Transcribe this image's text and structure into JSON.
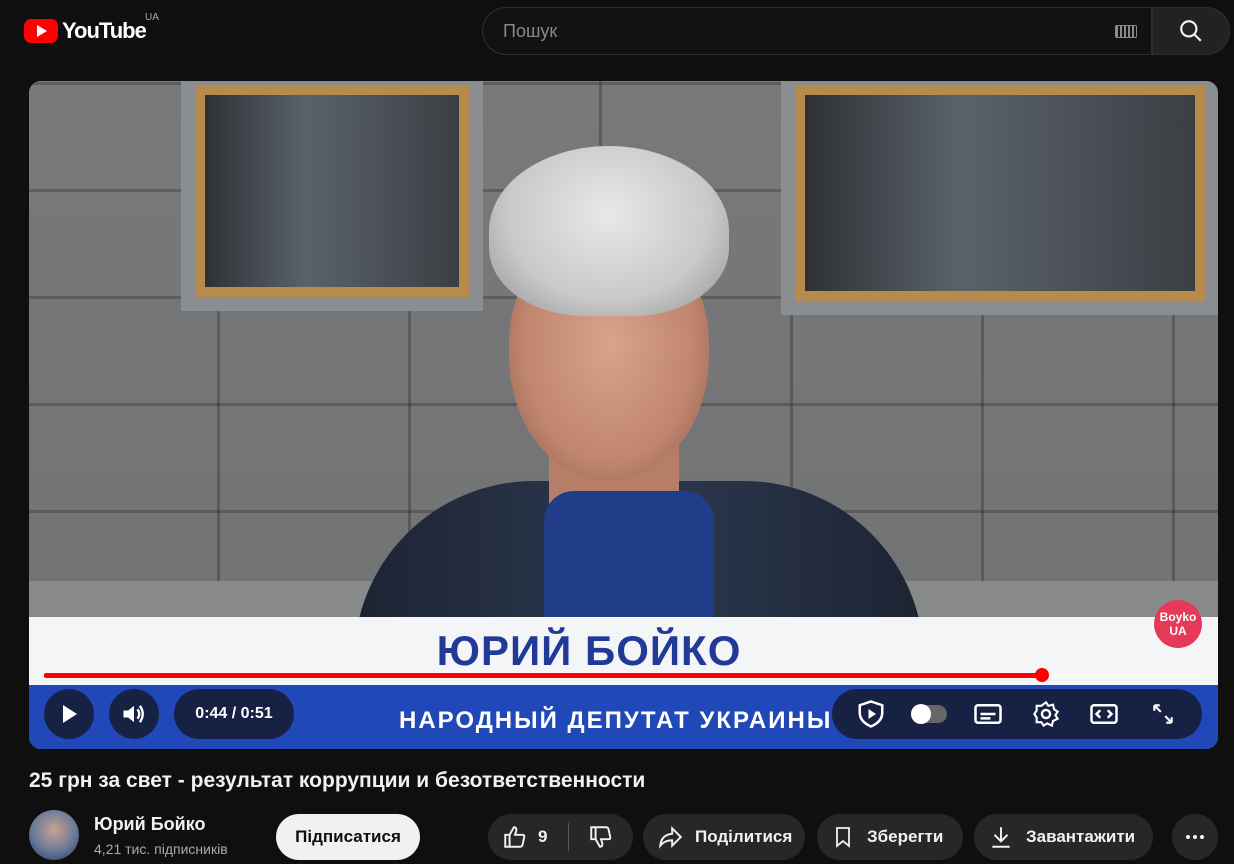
{
  "header": {
    "logo_text": "YouTube",
    "region": "UA",
    "search_placeholder": "Пошук"
  },
  "player": {
    "overlay_name": "ЮРИЙ БОЙКО",
    "overlay_title": "НАРОДНЫЙ  ДЕПУТАТ  УКРАИНЫ",
    "badge_line1": "Boyko",
    "badge_line2": "UA",
    "time": "0:44 / 0:51",
    "progress": 0.862
  },
  "video": {
    "title": "25 грн за свет - результат коррупции и безответственности"
  },
  "channel": {
    "name": "Юрий Бойко",
    "subscribers": "4,21 тис. підписників",
    "subscribe_label": "Підписатися"
  },
  "actions": {
    "like_count": "9",
    "share_label": "Поділитися",
    "save_label": "Зберегти",
    "download_label": "Завантажити"
  },
  "colors": {
    "accent": "#ff0000",
    "overlay_blue": "#2048b8",
    "overlay_name": "#213a97"
  }
}
